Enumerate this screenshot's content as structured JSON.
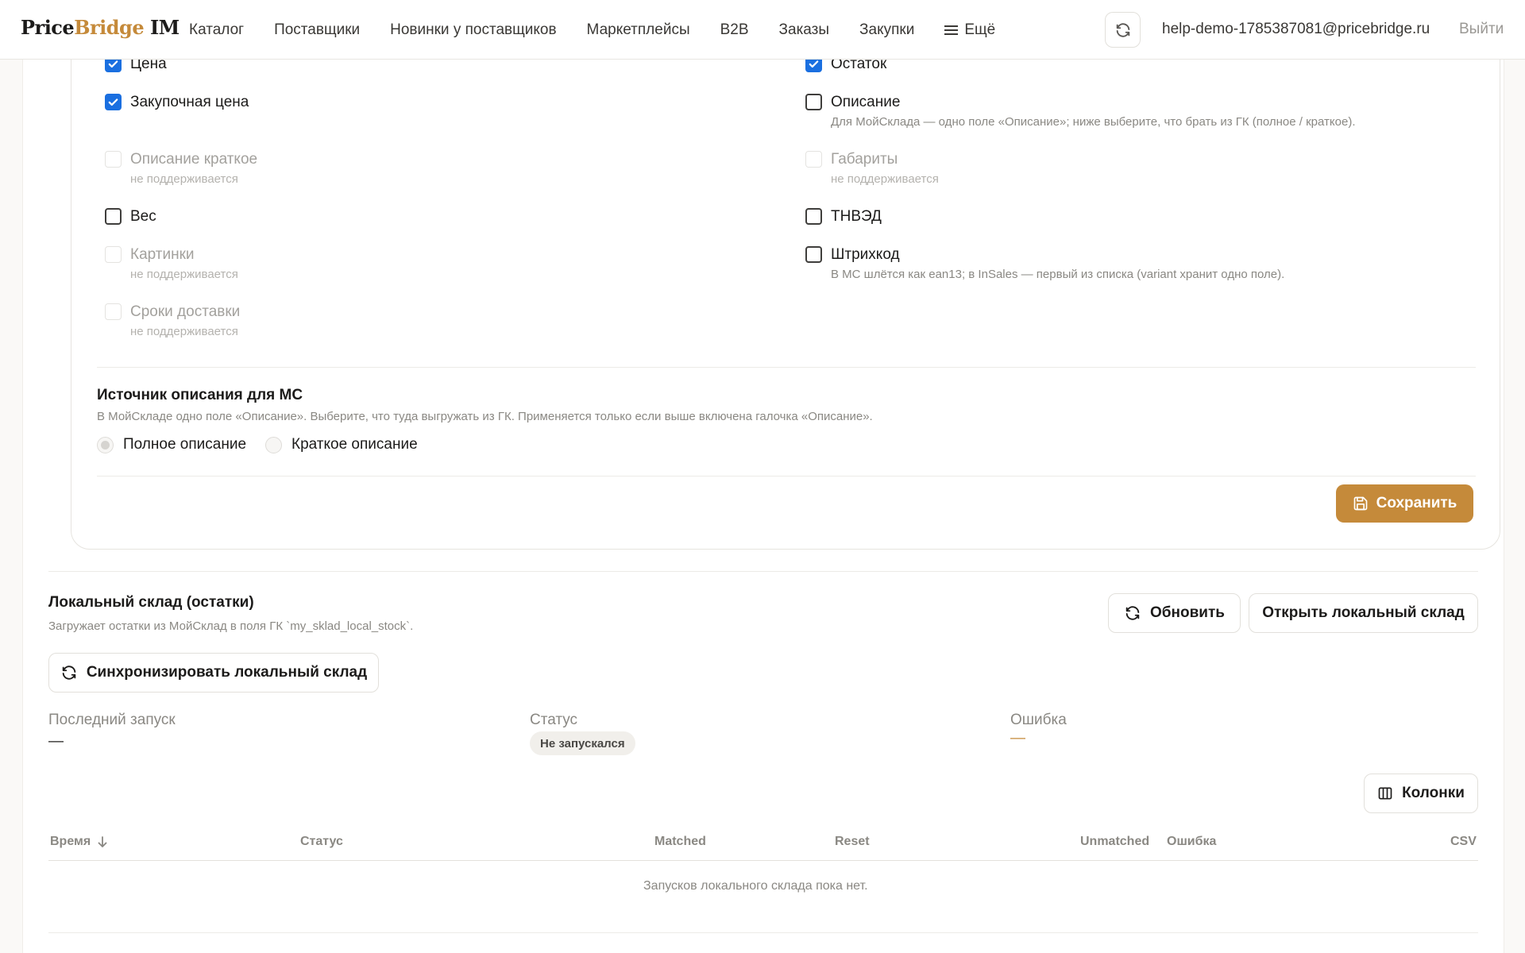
{
  "colors": {
    "accent": "#c58a3a",
    "checkbox_checked": "#1a6fe0",
    "error_dash": "#c58a3a"
  },
  "header": {
    "logo_price": "Price",
    "logo_bridge": "Bridge",
    "logo_im": " IM",
    "nav": [
      "Каталог",
      "Поставщики",
      "Новинки у поставщиков",
      "Маркетплейсы",
      "B2B",
      "Заказы",
      "Закупки",
      "Ещё"
    ],
    "refresh_icon": "refresh-icon",
    "email": "help-demo-1785387081@pricebridge.ru",
    "logout": "Выйти"
  },
  "fields_left": [
    {
      "label": "Цена",
      "state": "checked",
      "hint": ""
    },
    {
      "label": "Закупочная цена",
      "state": "checked",
      "hint": ""
    },
    {
      "label": "Описание краткое",
      "state": "disabled",
      "hint": "не поддерживается"
    },
    {
      "label": "Вес",
      "state": "unchecked",
      "hint": ""
    },
    {
      "label": "Картинки",
      "state": "disabled",
      "hint": "не поддерживается"
    },
    {
      "label": "Сроки доставки",
      "state": "disabled",
      "hint": "не поддерживается"
    }
  ],
  "fields_right": [
    {
      "label": "Остаток",
      "state": "checked",
      "hint": ""
    },
    {
      "label": "Описание",
      "state": "unchecked",
      "hint": "Для МойСклада — одно поле «Описание»; ниже выберите, что брать из ГК (полное / краткое)."
    },
    {
      "label": "Габариты",
      "state": "disabled",
      "hint": "не поддерживается"
    },
    {
      "label": "ТНВЭД",
      "state": "unchecked",
      "hint": ""
    },
    {
      "label": "Штрихкод",
      "state": "unchecked",
      "hint": "В МС шлётся как ean13; в InSales — первый из списка (variant хранит одно поле)."
    }
  ],
  "desc_source": {
    "title": "Источник описания для МС",
    "subtitle": "В МойСкладе одно поле «Описание». Выберите, что туда выгружать из ГК. Применяется только если выше включена галочка «Описание».",
    "options": [
      "Полное описание",
      "Краткое описание"
    ],
    "selected_option": "Полное описание"
  },
  "save_label": "Сохранить",
  "local_stock": {
    "title": "Локальный склад (остатки)",
    "subtitle": "Загружает остатки из МойСклад в поля ГК `my_sklad_local_stock`.",
    "refresh_label": "Обновить",
    "open_label": "Открыть локальный склад",
    "sync_label": "Синхронизировать локальный склад",
    "last_run_label": "Последний запуск",
    "last_run_value": "—",
    "status_label": "Статус",
    "status_value": "Не запускался",
    "error_label": "Ошибка",
    "error_value": "—",
    "columns_label": "Колонки",
    "table_headers": [
      "Время",
      "Статус",
      "Matched",
      "Reset",
      "Unmatched",
      "Ошибка",
      "CSV"
    ],
    "sort_icon": "arrow-down-icon",
    "empty": "Запусков локального склада пока нет."
  }
}
